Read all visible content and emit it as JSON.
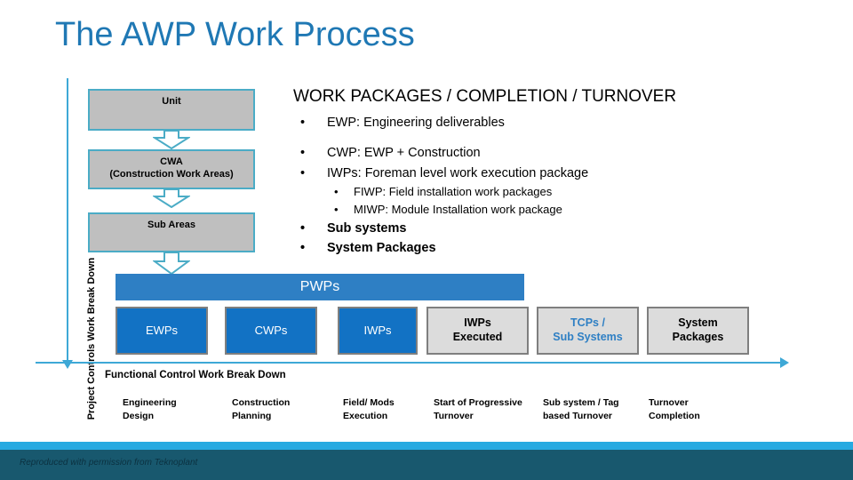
{
  "slide": {
    "title": "The AWP Work Process"
  },
  "left_axis": {
    "label": "Project Controls Work Break Down"
  },
  "flow_boxes": [
    {
      "label": "Unit"
    },
    {
      "label": "CWA",
      "label2": "(Construction Work Areas)"
    },
    {
      "label": "Sub Areas"
    }
  ],
  "banner": {
    "label": "PWPs"
  },
  "package_boxes": [
    {
      "line1": "EWPs",
      "line2": "",
      "style": "blue"
    },
    {
      "line1": "CWPs",
      "line2": "",
      "style": "blue"
    },
    {
      "line1": "IWPs",
      "line2": "",
      "style": "blue"
    },
    {
      "line1": "IWPs",
      "line2": "Executed",
      "style": "grey"
    },
    {
      "line1": "TCPs /",
      "line2": "Sub Systems",
      "style": "grey-accent"
    },
    {
      "line1": "System",
      "line2": "Packages",
      "style": "grey"
    }
  ],
  "right_panel": {
    "heading": "WORK PACKAGES / COMPLETION / TURNOVER",
    "bullets": [
      {
        "level": 1,
        "marker": "•",
        "text": "EWP: Engineering deliverables"
      },
      {
        "level": 1,
        "marker": "•",
        "text": "CWP: EWP + Construction"
      },
      {
        "level": 1,
        "marker": "•",
        "text": "IWPs: Foreman level work execution package"
      },
      {
        "level": 2,
        "marker": "•",
        "text": "FIWP: Field installation work packages"
      },
      {
        "level": 2,
        "marker": "•",
        "text": "MIWP: Module Installation work package"
      },
      {
        "level": 1,
        "marker": "•",
        "text": "Sub systems"
      },
      {
        "level": 1,
        "marker": "•",
        "text": "System Packages"
      }
    ]
  },
  "bottom_axis": {
    "label": "Functional Control Work Break Down",
    "columns": [
      {
        "line1": "Engineering",
        "line2": "Design"
      },
      {
        "line1": "Construction",
        "line2": "Planning"
      },
      {
        "line1": "Field/ Mods",
        "line2": "Execution"
      },
      {
        "line1": "Start of Progressive",
        "line2": "Turnover"
      },
      {
        "line1": "Sub system / Tag",
        "line2": "based Turnover"
      },
      {
        "line1": "Turnover",
        "line2": "Completion"
      }
    ]
  },
  "footer": {
    "credit": "Reproduced with permission from Teknoplant"
  },
  "colors": {
    "title_blue": "#1F78B4",
    "axis_blue": "#3EA8D6",
    "box_grey": "#BFBFBF",
    "box_border": "#4BACC6",
    "banner_blue": "#2E7FC4",
    "package_blue": "#1272C4",
    "package_grey": "#DCDCDC",
    "accent_text": "#2E7FC4",
    "band_cyan": "#27AAE1",
    "band_dark": "#18586E"
  }
}
